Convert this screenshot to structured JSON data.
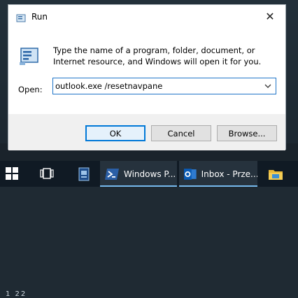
{
  "dialog": {
    "title": "Run",
    "description": "Type the name of a program, folder, document, or Internet resource, and Windows will open it for you.",
    "open_label": "Open:",
    "open_value": "outlook.exe /resetnavpane",
    "buttons": {
      "ok": "OK",
      "cancel": "Cancel",
      "browse": "Browse..."
    },
    "icons": {
      "title": "run-icon",
      "close": "close-icon",
      "big": "run-icon",
      "dropdown": "chevron-down-icon"
    }
  },
  "desktop": {
    "tray_text": "1 22"
  },
  "taskbar": {
    "items": [
      {
        "icon": "windows-start-icon"
      },
      {
        "icon": "task-view-icon"
      },
      {
        "icon": "remote-desktop-icon"
      },
      {
        "icon": "powershell-icon",
        "label": "Windows P..."
      },
      {
        "icon": "outlook-icon",
        "label": "Inbox - Prze..."
      },
      {
        "icon": "file-explorer-icon"
      }
    ],
    "accent_color": "#76b9ed"
  },
  "colors": {
    "focus_border": "#0078d7",
    "taskbar": "#101a24"
  }
}
